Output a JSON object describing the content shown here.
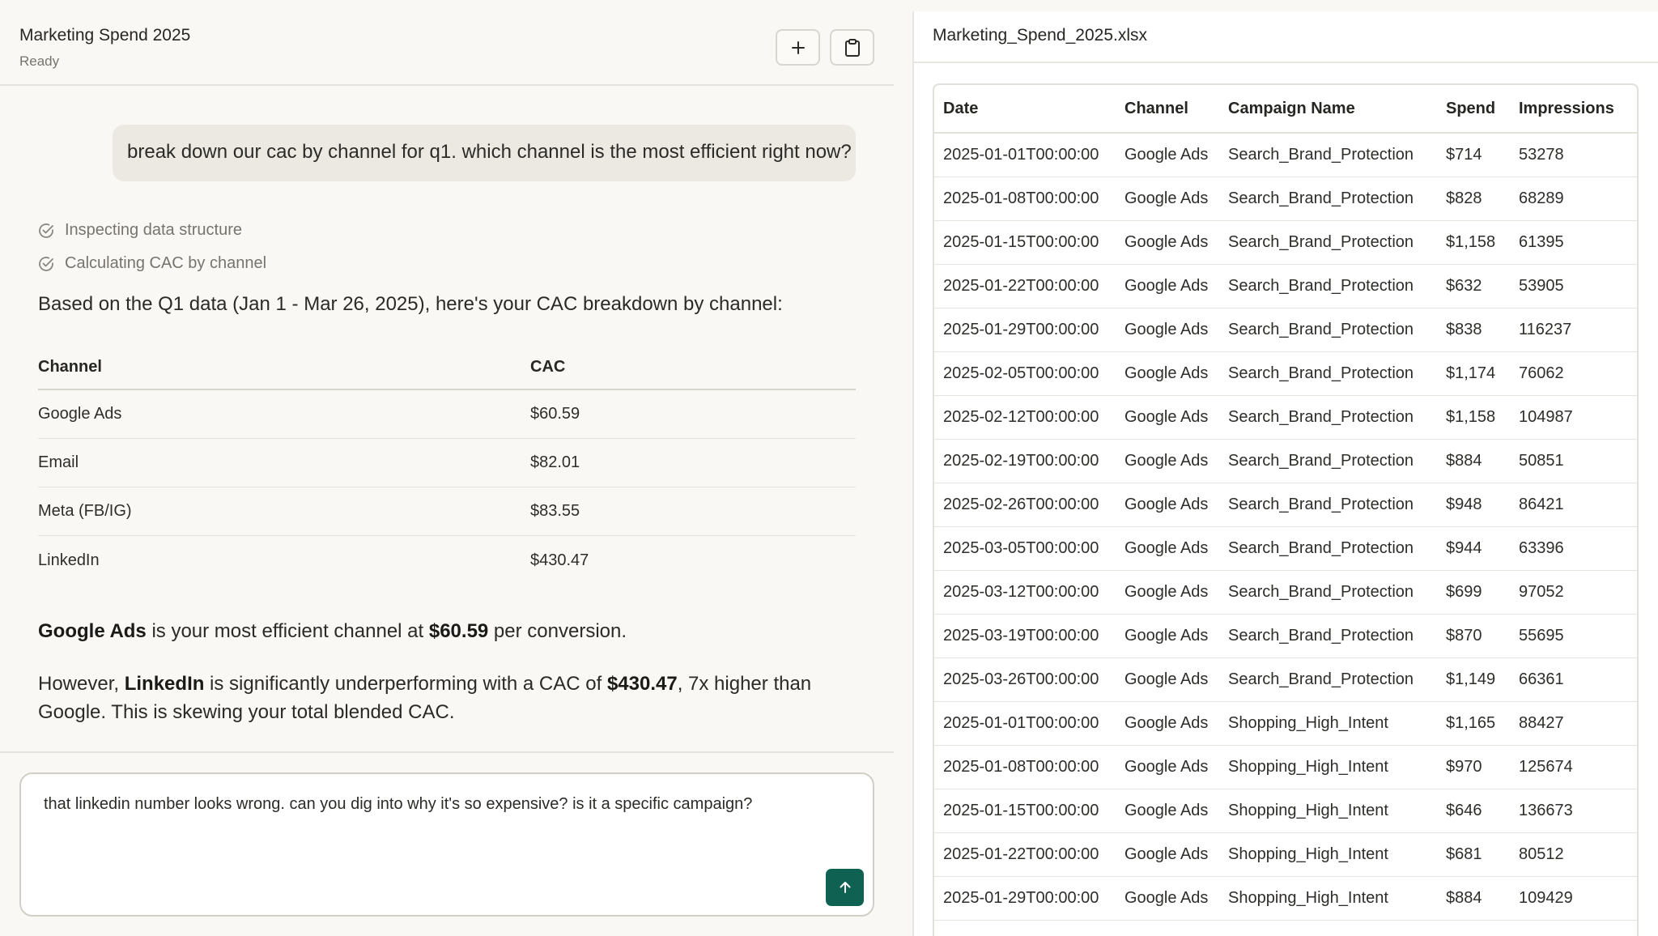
{
  "chat": {
    "title": "Marketing Spend 2025",
    "status": "Ready",
    "user_message": "break down our cac by channel for q1. which channel is the most efficient right now?",
    "steps": [
      "Inspecting data structure",
      "Calculating CAC by channel"
    ],
    "intro": "Based on the Q1 data (Jan 1 - Mar 26, 2025), here's your CAC breakdown by channel:",
    "cac_table": {
      "headers": [
        "Channel",
        "CAC"
      ],
      "rows": [
        {
          "channel": "Google Ads",
          "cac": "$60.59"
        },
        {
          "channel": "Email",
          "cac": "$82.01"
        },
        {
          "channel": "Meta (FB/IG)",
          "cac": "$83.55"
        },
        {
          "channel": "LinkedIn",
          "cac": "$430.47"
        }
      ]
    },
    "summary1": {
      "p1": "Google Ads",
      "p2": " is your most efficient channel at ",
      "p3": "$60.59",
      "p4": " per conversion."
    },
    "summary2": {
      "p1": "However, ",
      "p2": "LinkedIn",
      "p3": " is significantly underperforming with a CAC of ",
      "p4": "$430.47",
      "p5": ", 7x higher than Google. This is skewing your total blended CAC."
    },
    "composer_value": "that linkedin number looks wrong. can you dig into why it's so expensive? is it a specific campaign?"
  },
  "icons": {
    "new_chat": "plus-icon",
    "copy": "clipboard-icon",
    "step_done": "check-circle-icon",
    "send": "arrow-up-icon"
  },
  "colors": {
    "background": "#f9f8f4",
    "send_button": "#0f6152",
    "user_bubble": "#ebe9e1"
  },
  "sheet": {
    "filename": "Marketing_Spend_2025.xlsx",
    "headers": [
      "Date",
      "Channel",
      "Campaign Name",
      "Spend",
      "Impressions"
    ],
    "rows": [
      [
        "2025-01-01T00:00:00",
        "Google Ads",
        "Search_Brand_Protection",
        "$714",
        "53278"
      ],
      [
        "2025-01-08T00:00:00",
        "Google Ads",
        "Search_Brand_Protection",
        "$828",
        "68289"
      ],
      [
        "2025-01-15T00:00:00",
        "Google Ads",
        "Search_Brand_Protection",
        "$1,158",
        "61395"
      ],
      [
        "2025-01-22T00:00:00",
        "Google Ads",
        "Search_Brand_Protection",
        "$632",
        "53905"
      ],
      [
        "2025-01-29T00:00:00",
        "Google Ads",
        "Search_Brand_Protection",
        "$838",
        "116237"
      ],
      [
        "2025-02-05T00:00:00",
        "Google Ads",
        "Search_Brand_Protection",
        "$1,174",
        "76062"
      ],
      [
        "2025-02-12T00:00:00",
        "Google Ads",
        "Search_Brand_Protection",
        "$1,158",
        "104987"
      ],
      [
        "2025-02-19T00:00:00",
        "Google Ads",
        "Search_Brand_Protection",
        "$884",
        "50851"
      ],
      [
        "2025-02-26T00:00:00",
        "Google Ads",
        "Search_Brand_Protection",
        "$948",
        "86421"
      ],
      [
        "2025-03-05T00:00:00",
        "Google Ads",
        "Search_Brand_Protection",
        "$944",
        "63396"
      ],
      [
        "2025-03-12T00:00:00",
        "Google Ads",
        "Search_Brand_Protection",
        "$699",
        "97052"
      ],
      [
        "2025-03-19T00:00:00",
        "Google Ads",
        "Search_Brand_Protection",
        "$870",
        "55695"
      ],
      [
        "2025-03-26T00:00:00",
        "Google Ads",
        "Search_Brand_Protection",
        "$1,149",
        "66361"
      ],
      [
        "2025-01-01T00:00:00",
        "Google Ads",
        "Shopping_High_Intent",
        "$1,165",
        "88427"
      ],
      [
        "2025-01-08T00:00:00",
        "Google Ads",
        "Shopping_High_Intent",
        "$970",
        "125674"
      ],
      [
        "2025-01-15T00:00:00",
        "Google Ads",
        "Shopping_High_Intent",
        "$646",
        "136673"
      ],
      [
        "2025-01-22T00:00:00",
        "Google Ads",
        "Shopping_High_Intent",
        "$681",
        "80512"
      ],
      [
        "2025-01-29T00:00:00",
        "Google Ads",
        "Shopping_High_Intent",
        "$884",
        "109429"
      ]
    ]
  }
}
